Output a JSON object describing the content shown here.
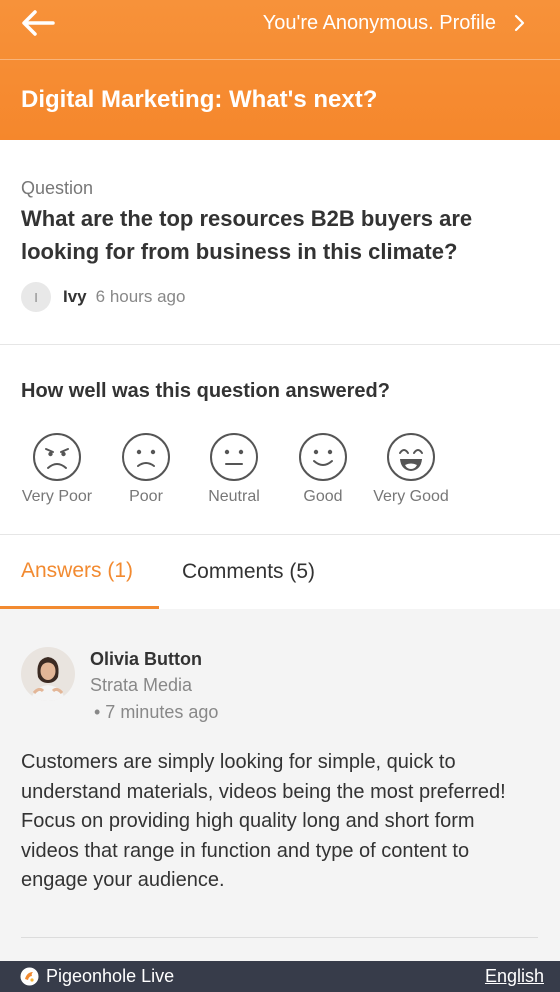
{
  "header": {
    "profile_label": "You're Anonymous. Profile",
    "session_title": "Digital Marketing: What's next?"
  },
  "question": {
    "label": "Question",
    "text": "What are the top resources B2B buyers are looking for from business in this climate?",
    "asker_initial": "I",
    "asker_name": "Ivy",
    "time": "6 hours ago"
  },
  "rating": {
    "prompt": "How well was this question answered?",
    "options": [
      {
        "label": "Very Poor",
        "icon": "very-poor-face-icon"
      },
      {
        "label": "Poor",
        "icon": "poor-face-icon"
      },
      {
        "label": "Neutral",
        "icon": "neutral-face-icon"
      },
      {
        "label": "Good",
        "icon": "good-face-icon"
      },
      {
        "label": "Very Good",
        "icon": "very-good-face-icon"
      }
    ]
  },
  "tabs": {
    "answers": "Answers (1)",
    "comments": "Comments (5)"
  },
  "answer": {
    "author": "Olivia Button",
    "company": "Strata Media",
    "time": "• 7 minutes ago",
    "body": "Customers are simply looking for simple, quick to understand materials, videos being the most preferred! Focus on providing high quality long and short form videos that range in function and type of content to engage your audience."
  },
  "footer": {
    "brand": "Pigeonhole Live",
    "language": "English"
  },
  "colors": {
    "accent": "#f28a30",
    "header_bg": "#f5872c",
    "footer_bg": "#373c4a"
  }
}
